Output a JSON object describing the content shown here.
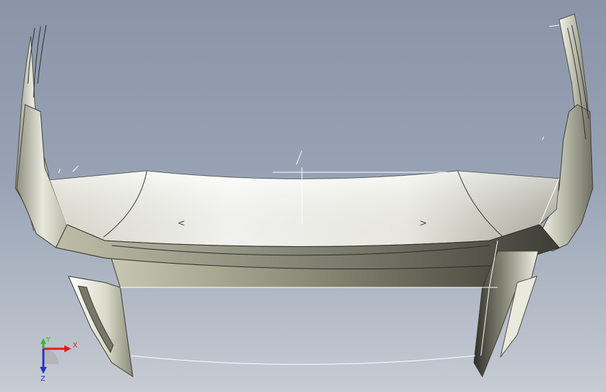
{
  "viewport": {
    "background_top": "#8a96a8",
    "background_bottom": "#c7cbd3",
    "model_color": "#e9e9dd"
  },
  "triad": {
    "x_label": "X",
    "y_label": "Y",
    "z_label": "Z",
    "x_color": "#e11b1b",
    "y_color": "#2eb82e",
    "z_color": "#2733c9"
  },
  "annotations": {
    "left_arrow": "<",
    "right_arrow": ">"
  }
}
